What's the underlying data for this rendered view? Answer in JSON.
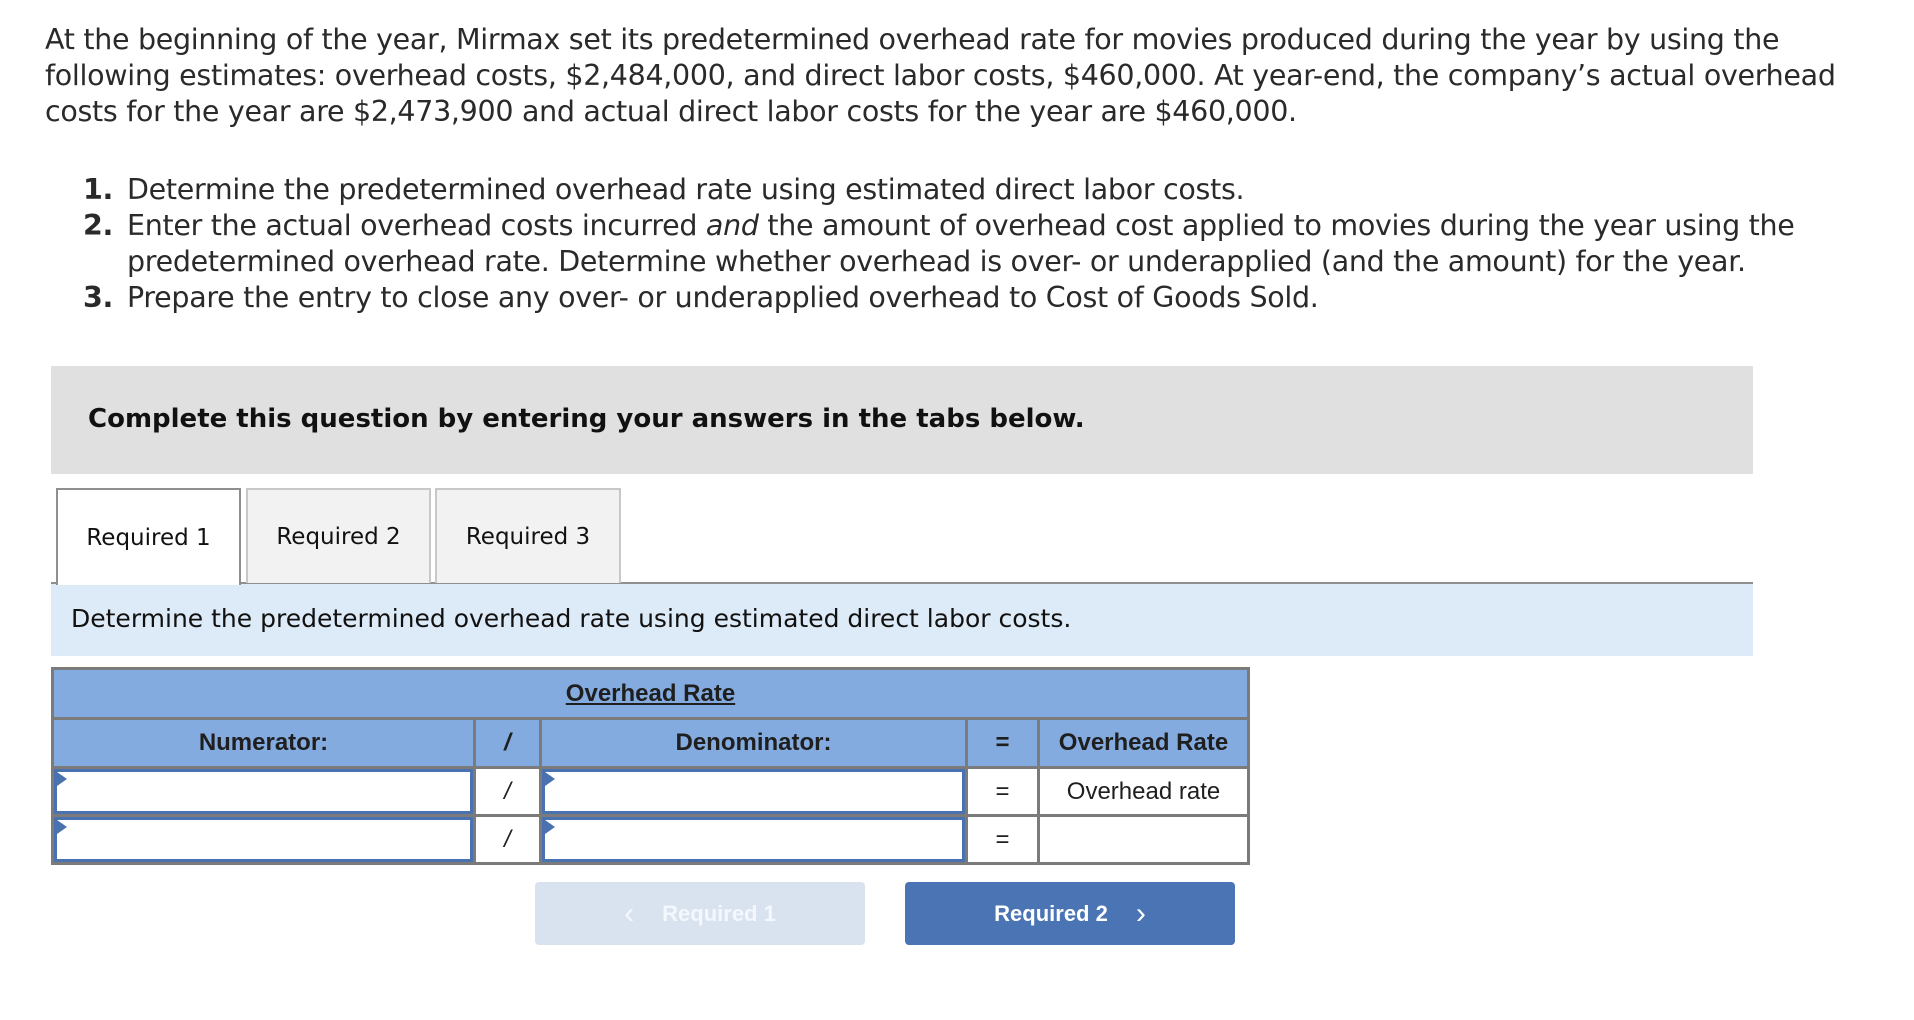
{
  "problem": {
    "intro": "At the beginning of the year, Mirmax set its predetermined overhead rate for movies produced during the year by using the following estimates: overhead costs, $2,484,000, and direct labor costs, $460,000. At year-end, the company’s actual overhead costs for the year are $2,473,900 and actual direct labor costs for the year are $460,000.",
    "requirements": [
      {
        "num": "1.",
        "text": "Determine the predetermined overhead rate using estimated direct labor costs."
      },
      {
        "num": "2.",
        "text_before": "Enter the actual overhead costs incurred ",
        "text_italic": "and",
        "text_after": " the amount of overhead cost applied to movies during the year using the predetermined overhead rate. Determine whether overhead is over- or underapplied (and the amount) for the year."
      },
      {
        "num": "3.",
        "text": "Prepare the entry to close any over- or underapplied overhead to Cost of Goods Sold."
      }
    ]
  },
  "instructions_box": {
    "message": "Complete this question by entering your answers in the tabs below."
  },
  "tabs": [
    {
      "label": "Required 1",
      "active": true
    },
    {
      "label": "Required 2",
      "active": false
    },
    {
      "label": "Required 3",
      "active": false
    }
  ],
  "banner": {
    "text": "Determine the predetermined overhead rate using estimated direct labor costs."
  },
  "table": {
    "title": "Overhead Rate",
    "headers": {
      "numerator": "Numerator:",
      "divide": "/",
      "denominator": "Denominator:",
      "equals": "=",
      "result": "Overhead Rate"
    },
    "rows": [
      {
        "numerator": "",
        "divide": "/",
        "denominator": "",
        "equals": "=",
        "result": "Overhead rate"
      },
      {
        "numerator": "",
        "divide": "/",
        "denominator": "",
        "equals": "=",
        "result": ""
      }
    ]
  },
  "navigation": {
    "prev_label": "Required 1",
    "prev_enabled": false,
    "next_label": "Required 2",
    "next_enabled": true,
    "prev_icon": "chevron-left-icon",
    "next_icon": "chevron-right-icon"
  },
  "colors": {
    "accent": "#4a74b3",
    "table_header": "#84abe0",
    "banner": "#ddeaf7",
    "instructions_bg": "#e0e0e0",
    "disabled_button": "#d9e3f0"
  }
}
